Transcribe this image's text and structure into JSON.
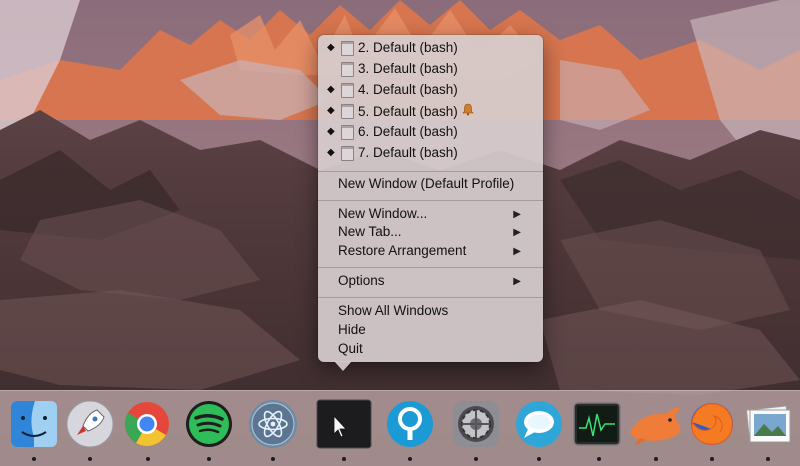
{
  "context_menu": {
    "windows": [
      {
        "label": "2. Default (bash)",
        "active": true,
        "bell": false
      },
      {
        "label": "3. Default (bash)",
        "active": false,
        "bell": false
      },
      {
        "label": "4. Default (bash)",
        "active": true,
        "bell": false
      },
      {
        "label": "5. Default (bash)",
        "active": true,
        "bell": true
      },
      {
        "label": "6. Default (bash)",
        "active": true,
        "bell": false
      },
      {
        "label": "7. Default (bash)",
        "active": true,
        "bell": false
      }
    ],
    "new_window_default": "New Window (Default Profile)",
    "new_window": "New Window...",
    "new_tab": "New Tab...",
    "restore_arrangement": "Restore Arrangement",
    "options": "Options",
    "show_all_windows": "Show All Windows",
    "hide": "Hide",
    "quit": "Quit"
  },
  "glyphs": {
    "diamond": "◆",
    "submenu_arrow": "▶",
    "bell": "🔔"
  },
  "dock": {
    "apps": [
      "finder-icon",
      "launchpad-icon",
      "chrome-icon",
      "spotify-icon",
      "atom-icon",
      "iterm-icon",
      "sourcetree-icon",
      "system-preferences-icon",
      "messages-icon",
      "activity-monitor-icon",
      "dolphin-icon",
      "firefox-icon",
      "preview-icon"
    ]
  },
  "colors": {
    "menu_bg": "#d6cccE",
    "alpenglow": "#e07b52",
    "dock_bg": "#c8b0b0"
  }
}
